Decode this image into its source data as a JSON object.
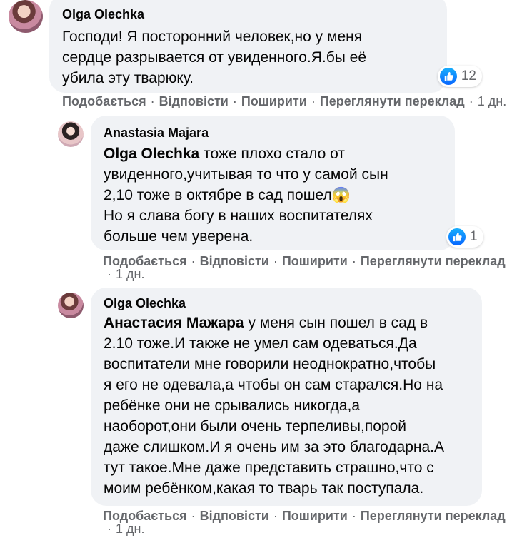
{
  "comments": [
    {
      "author": "Olga Olechka",
      "mention": "",
      "text": "Господи! Я посторонний человек,но у меня\nсердце разрывается от увиденного.Я.бы её\nубила эту тварюку.",
      "reaction_count": "12",
      "actions": {
        "like": "Подобається",
        "reply": "Відповісти",
        "share": "Поширити",
        "translate": "Переглянути переклад",
        "time": "1 дн."
      }
    },
    {
      "author": "Anastasia Majara",
      "mention": "Olga Olechka",
      "text": " тоже плохо стало от\nувиденного,учитывая то что у самой сын\n2,10 тоже в октябре в сад пошел😱\nНо я слава богу в наших воспитателях\nбольше чем уверена.",
      "reaction_count": "1",
      "actions": {
        "like": "Подобається",
        "reply": "Відповісти",
        "share": "Поширити",
        "translate": "Переглянути переклад",
        "time": "1 дн."
      }
    },
    {
      "author": "Olga Olechka",
      "mention": "Анастасия Мажара",
      "text": " у меня сын пошел в сад в\n2.10 тоже.И также не умел сам одеваться.Да\nвоспитатели мне говорили неоднократно,чтобы\nя его не одевала,а чтобы он сам старался.Но на\nребёнке они не срывались никогда,а\nнаоборот,они были очень терпеливы,порой\nдаже слишком.И я очень им за это благодарна.А\nтут такое.Мне даже представить страшно,что с\nмоим ребёнком,какая то тварь так поступала.",
      "actions": {
        "like": "Подобається",
        "reply": "Відповісти",
        "share": "Поширити",
        "translate": "Переглянути переклад",
        "time": "1 дн."
      }
    }
  ],
  "colors": {
    "bubble": "#f0f2f5",
    "meta": "#65676b",
    "like_blue": "#0866ff"
  },
  "icons": {
    "reaction": "like-icon"
  }
}
